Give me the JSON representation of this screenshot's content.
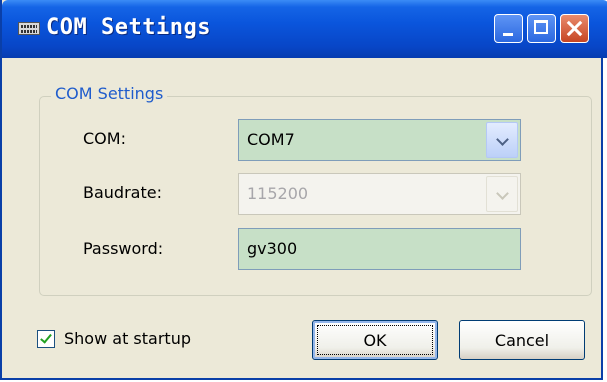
{
  "window": {
    "title": "COM Settings"
  },
  "group": {
    "title": "COM Settings"
  },
  "fields": {
    "com": {
      "label": "COM:",
      "value": "COM7"
    },
    "baudrate": {
      "label": "Baudrate:",
      "value": "115200"
    },
    "password": {
      "label": "Password:",
      "value": "gv300"
    }
  },
  "startup": {
    "label": "Show at startup",
    "checked": true
  },
  "buttons": {
    "ok": "OK",
    "cancel": "Cancel"
  }
}
